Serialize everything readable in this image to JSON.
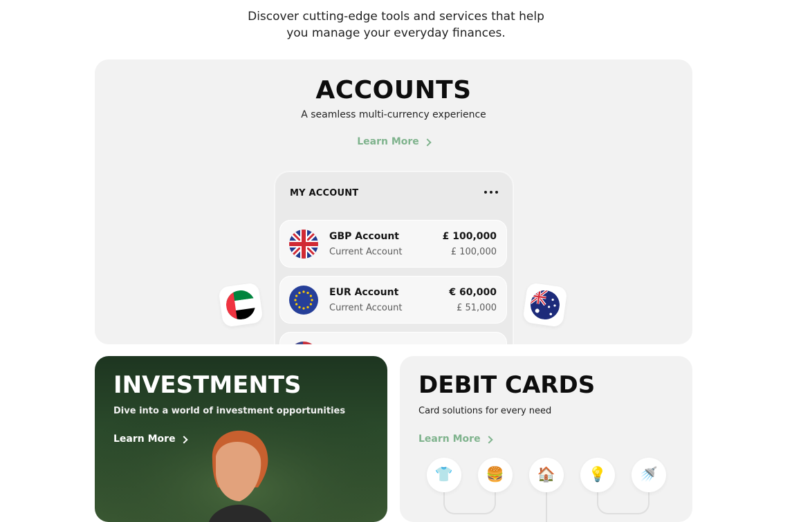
{
  "intro": {
    "line1": "Discover cutting-edge tools and services that help",
    "line2": "you manage your everyday finances."
  },
  "accounts": {
    "title": "ACCOUNTS",
    "subtitle": "A seamless multi-currency experience",
    "learn_more": "Learn More",
    "accent_color": "#7fb38d",
    "phone": {
      "title": "MY ACCOUNT",
      "menu_icon": "more-horizontal-icon",
      "rows": [
        {
          "flag": "uk-flag-icon",
          "name": "GBP Account",
          "type": "Current Account",
          "amount": "£ 100,000",
          "converted": "£ 100,000"
        },
        {
          "flag": "eu-flag-icon",
          "name": "EUR Account",
          "type": "Current Account",
          "amount": "€ 60,000",
          "converted": "£ 51,000"
        }
      ]
    },
    "floating_flags": [
      "uae-flag-icon",
      "australia-flag-icon"
    ]
  },
  "investments": {
    "title": "INVESTMENTS",
    "subtitle": "Dive into a world of investment opportunities",
    "learn_more": "Learn More"
  },
  "debit_cards": {
    "title": "DEBIT CARDS",
    "subtitle": "Card solutions for every need",
    "learn_more": "Learn More",
    "categories": [
      {
        "icon": "shirt-icon",
        "glyph": "👕"
      },
      {
        "icon": "burger-icon",
        "glyph": "🍔"
      },
      {
        "icon": "house-icon",
        "glyph": "🏠"
      },
      {
        "icon": "lightbulb-icon",
        "glyph": "💡"
      },
      {
        "icon": "shower-icon",
        "glyph": "🚿"
      }
    ]
  }
}
